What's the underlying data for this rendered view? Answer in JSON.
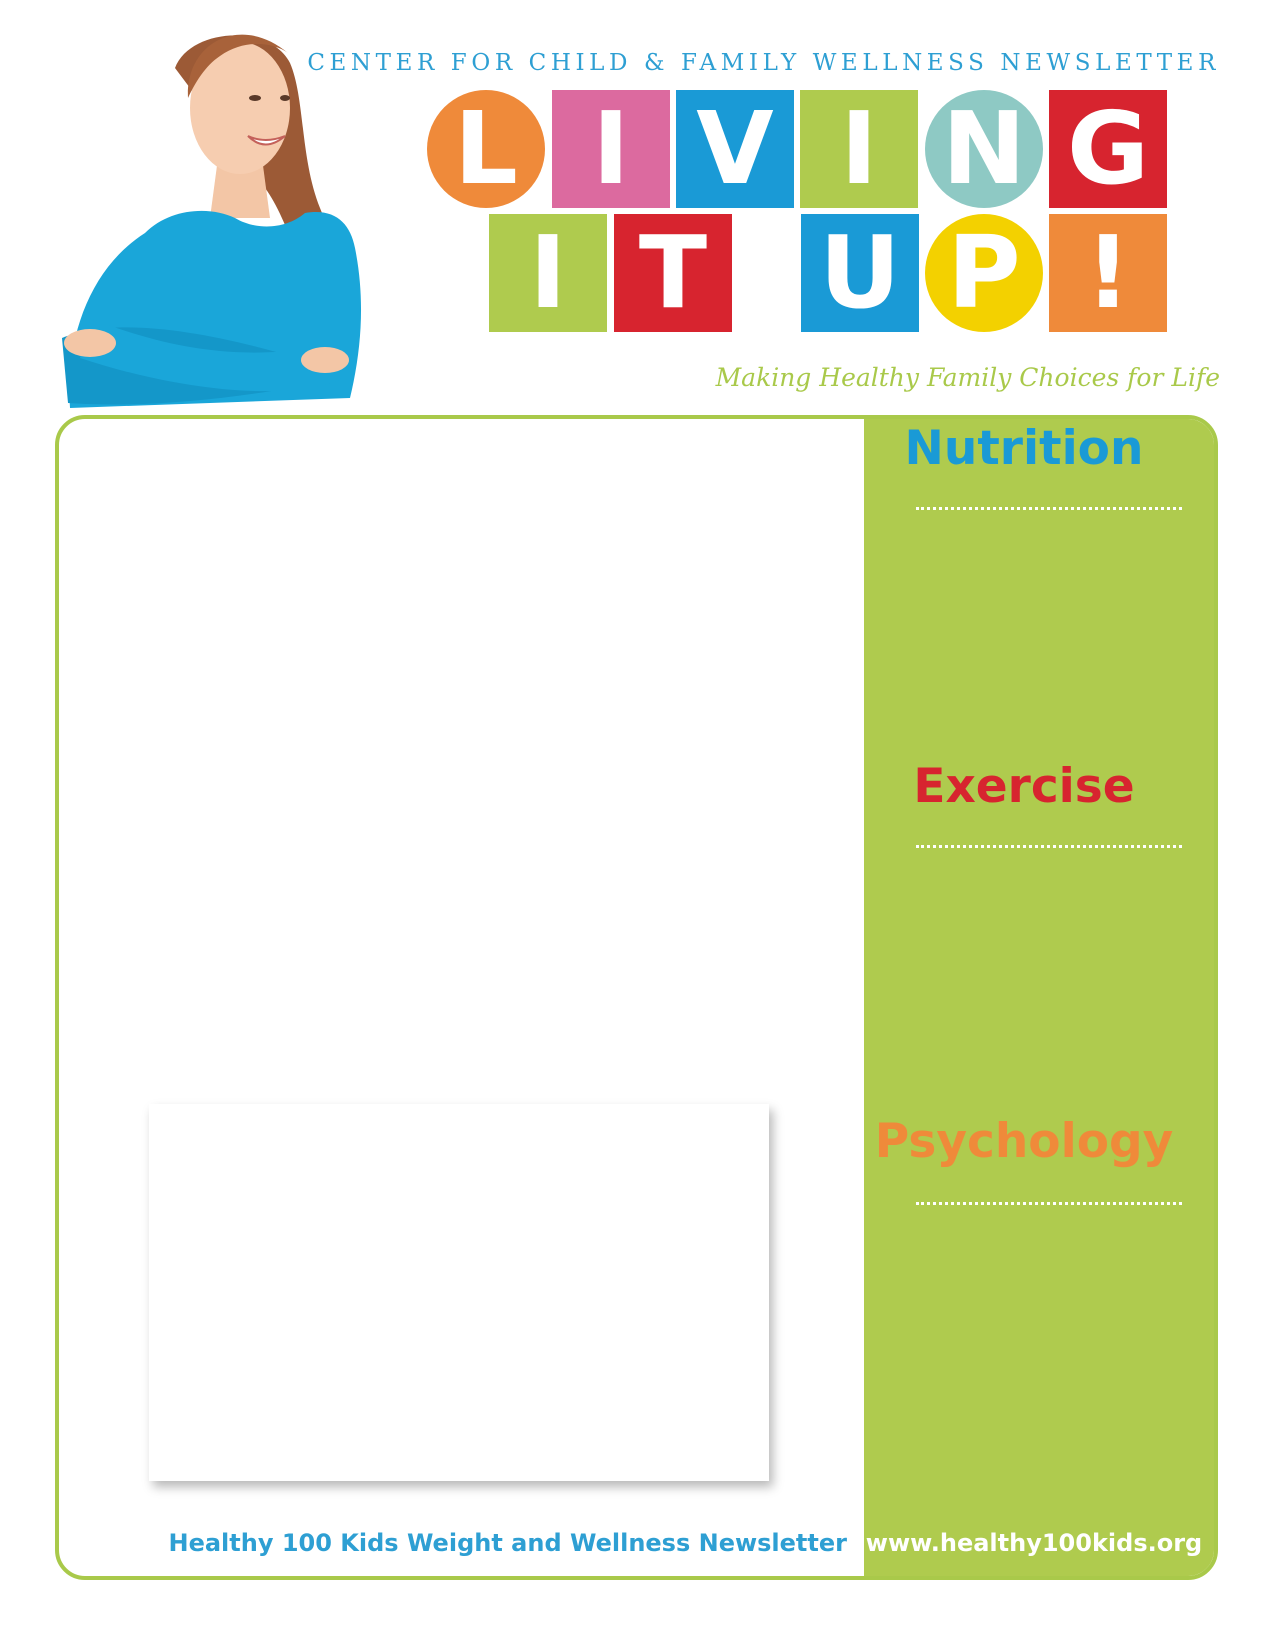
{
  "header": {
    "org_title": "CENTER FOR CHILD & FAMILY WELLNESS NEWSLETTER",
    "logo_line1": [
      "L",
      "I",
      "V",
      "I",
      "N",
      "G"
    ],
    "logo_line2": [
      "I",
      "T",
      "U",
      "P",
      "!"
    ],
    "tagline": "Making Healthy Family Choices for Life"
  },
  "sidebar": {
    "sections": [
      {
        "label": "Nutrition",
        "color": "#1a9ad6"
      },
      {
        "label": "Exercise",
        "color": "#d7242f"
      },
      {
        "label": "Psychology",
        "color": "#ef8a3a"
      }
    ]
  },
  "footer": {
    "newsletter_name": "Healthy 100 Kids Weight and Wellness Newsletter",
    "website": "www.healthy100kids.org"
  },
  "colors": {
    "brand_green": "#afcb4e",
    "brand_blue": "#2e9fd3",
    "orange": "#ef8a3a",
    "pink": "#dc6a9f",
    "blue": "#1a9ad6",
    "teal": "#8ec9c4",
    "red": "#d7242f",
    "yellow": "#f3d100"
  }
}
